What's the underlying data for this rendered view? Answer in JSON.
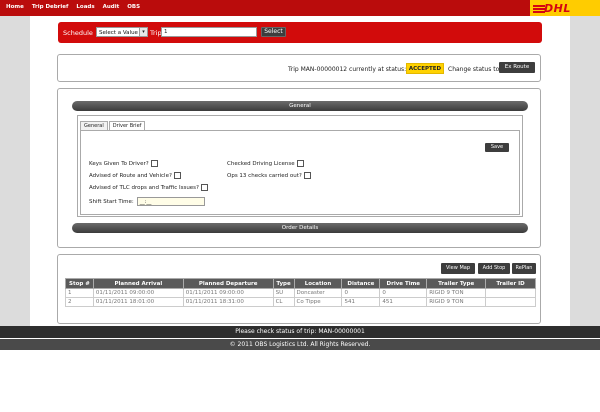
{
  "nav": {
    "items": [
      "Home",
      "Trip Debrief",
      "Loads",
      "Audit",
      "OBS"
    ],
    "logo_text": "DHL",
    "brand_color": "#d40511",
    "logo_bg": "#ffcc00"
  },
  "schedule": {
    "label": "Schedule",
    "select_value": "Select a Value",
    "trip_label": "Trip",
    "trip_value": "1",
    "select_button": "Select"
  },
  "status": {
    "text": "Trip MAN-00000012 currently at status:",
    "badge": "ACCEPTED",
    "change_text": "Change status to:",
    "change_button": "Ex Route"
  },
  "general": {
    "title": "General",
    "tabs": [
      "General",
      "Driver Brief"
    ],
    "active_tab": "Driver Brief",
    "save_button": "Save",
    "questions": {
      "keys": "Keys Given To Driver?",
      "route": "Advised of Route and Vehicle?",
      "tlc": "Advised of TLC drops and Traffic Issues?",
      "license": "Checked Driving License",
      "ops": "Ops 13 checks carried out?",
      "shift": "Shift Start Time:"
    },
    "shift_placeholder": "__:__"
  },
  "order": {
    "title": "Order Details"
  },
  "stops": {
    "buttons": {
      "view_map": "View Map",
      "add_stop": "Add Stop",
      "replan": "RePlan"
    },
    "columns": [
      "Stop #",
      "Planned Arrival",
      "Planned Departure",
      "Type",
      "Location",
      "Distance",
      "Drive Time",
      "Trailer Type",
      "Trailer ID"
    ],
    "rows": [
      [
        "1",
        "01/11/2011 09:00:00",
        "01/11/2011 09:00:00",
        "SU",
        "Doncaster",
        "0",
        "0",
        "RIGID 9 TON",
        ""
      ],
      [
        "2",
        "01/11/2011 18:01:00",
        "01/11/2011 18:31:00",
        "CL",
        "Co Tippe",
        "541",
        "451",
        "RIGID 9 TON",
        ""
      ]
    ]
  },
  "footer": {
    "notice": "Please check status of trip: MAN-00000001",
    "copyright": "© 2011 OBS Logistics Ltd. All Rights Reserved."
  }
}
